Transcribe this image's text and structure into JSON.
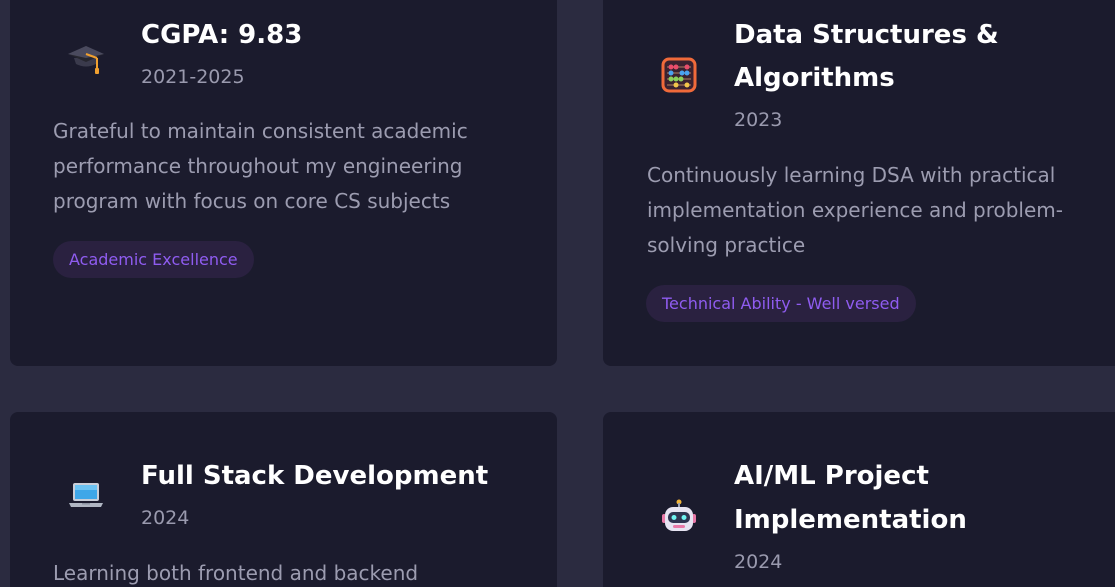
{
  "cards": [
    {
      "icon": "graduation-cap-icon",
      "title": "CGPA: 9.83",
      "year": "2021-2025",
      "description": "Grateful to maintain consistent academic performance throughout my engineering program with focus on core CS subjects",
      "badge": "Academic Excellence"
    },
    {
      "icon": "abacus-icon",
      "title_line1": "Data Structures &",
      "title_line2": "Algorithms",
      "year": "2023",
      "description": "Continuously learning DSA with practical implementation experience and problem-solving practice",
      "badge": "Technical Ability - Well versed"
    },
    {
      "icon": "laptop-icon",
      "title": "Full Stack Development",
      "year": "2024",
      "description": "Learning both frontend and backend"
    },
    {
      "icon": "robot-icon",
      "title_line1": "AI/ML Project",
      "title_line2": "Implementation",
      "year": "2024"
    }
  ],
  "colors": {
    "page_background": "#2b2b40",
    "card_background": "#1b1b2d",
    "title": "#ffffff",
    "muted_text": "#9c9cb0",
    "badge_background": "#2a2140",
    "badge_text": "#8f5cf0"
  }
}
